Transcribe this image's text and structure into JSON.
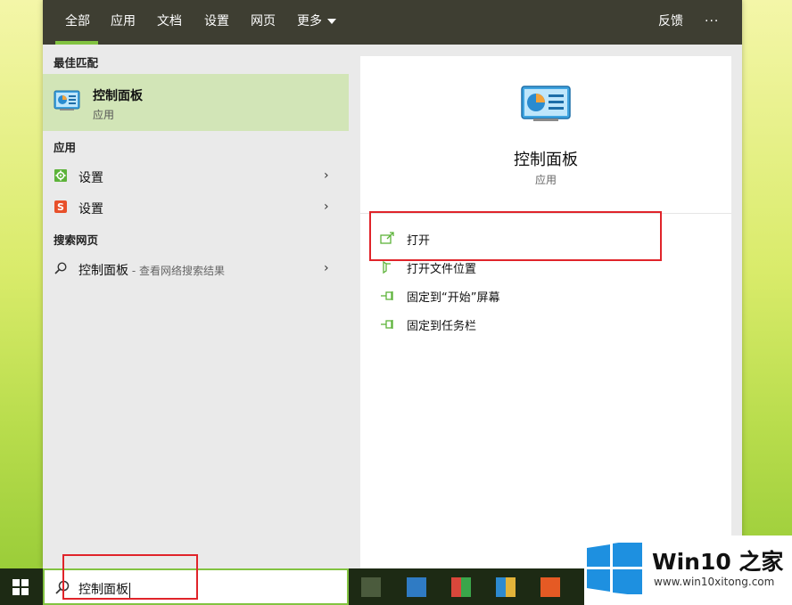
{
  "tabs": {
    "all": "全部",
    "apps": "应用",
    "docs": "文档",
    "settings": "设置",
    "web": "网页",
    "more": "更多",
    "feedback": "反馈",
    "ellipsis": "···"
  },
  "left": {
    "best_match_title": "最佳匹配",
    "best_match": {
      "title": "控制面板",
      "subtitle": "应用",
      "icon": "control-panel-icon"
    },
    "apps_title": "应用",
    "apps": [
      {
        "label": "设置",
        "icon": "settings-gear-icon",
        "chevron": "›"
      },
      {
        "label": "设置",
        "icon": "s-app-icon",
        "chevron": "›"
      }
    ],
    "web_title": "搜索网页",
    "web_item": {
      "label": "控制面板",
      "suffix": " - 查看网络搜索结果",
      "icon": "search-icon",
      "chevron": "›"
    }
  },
  "right": {
    "title": "控制面板",
    "subtitle": "应用",
    "actions": [
      {
        "label": "打开",
        "icon": "open-icon"
      },
      {
        "label": "打开文件位置",
        "icon": "file-location-icon"
      },
      {
        "label": "固定到“开始”屏幕",
        "icon": "pin-icon"
      },
      {
        "label": "固定到任务栏",
        "icon": "pin-icon"
      }
    ]
  },
  "search": {
    "value": "控制面板"
  },
  "watermark": {
    "brand": "Win10 之家",
    "url": "www.win10xitong.com"
  },
  "colors": {
    "accent": "#82c341",
    "topbar": "#3e3e32",
    "best_match_bg": "#d2e5b7",
    "highlight": "#e0242a"
  }
}
